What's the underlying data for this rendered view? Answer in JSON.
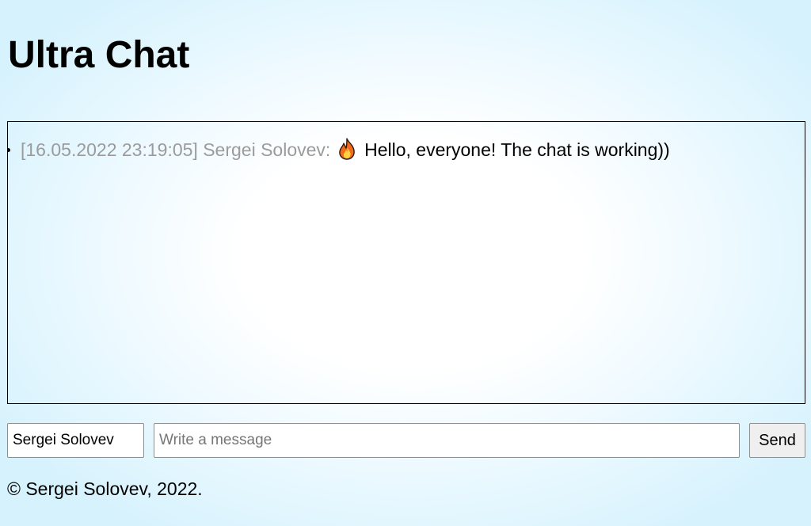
{
  "header": {
    "title": "Ultra Chat"
  },
  "chat": {
    "messages": [
      {
        "timestamp": "[16.05.2022 23:19:05]",
        "author": "Sergei Solovev:",
        "icon": "fire-icon",
        "text": "Hello, everyone! The chat is working))"
      }
    ]
  },
  "form": {
    "name_value": "Sergei Solovev",
    "message_placeholder": "Write a message",
    "send_label": "Send"
  },
  "footer": {
    "text": "© Sergei Solovev, 2022."
  },
  "colors": {
    "meta_text": "#9b9b9b",
    "background_edge": "#d6f2fd"
  }
}
